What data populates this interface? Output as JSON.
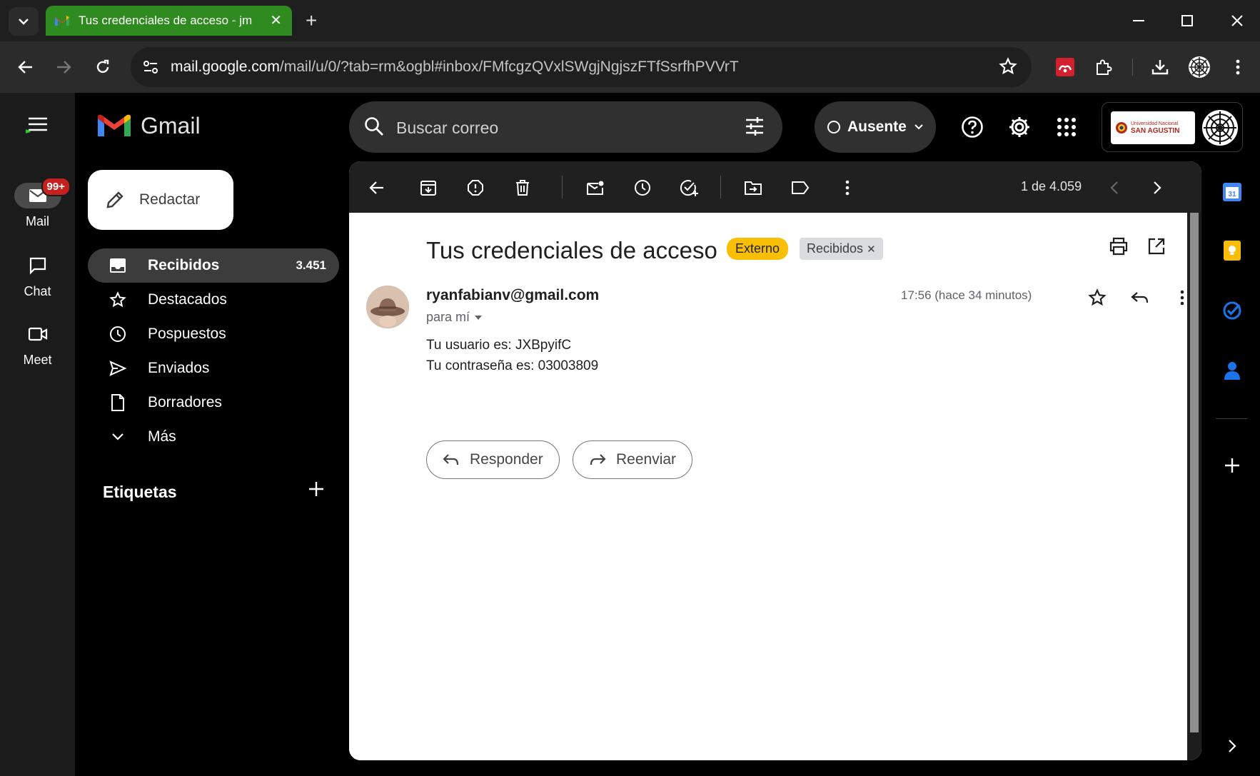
{
  "browser": {
    "tab_title": "Tus credenciales de acceso - jm",
    "url_host": "mail.google.com",
    "url_path": "/mail/u/0/?tab=rm&ogbl#inbox/FMfcgzQVxlSWgjNgjszFTfSsrfhPVVrT"
  },
  "rail": {
    "mail_label": "Mail",
    "mail_badge": "99+",
    "chat_label": "Chat",
    "meet_label": "Meet"
  },
  "sidebar": {
    "app_name": "Gmail",
    "compose_label": "Redactar",
    "items": [
      {
        "label": "Recibidos",
        "count": "3.451",
        "icon": "inbox-icon"
      },
      {
        "label": "Destacados",
        "icon": "star-icon"
      },
      {
        "label": "Pospuestos",
        "icon": "clock-icon"
      },
      {
        "label": "Enviados",
        "icon": "send-icon"
      },
      {
        "label": "Borradores",
        "icon": "draft-icon"
      },
      {
        "label": "Más",
        "icon": "chevron-down-icon"
      }
    ],
    "labels_heading": "Etiquetas"
  },
  "header": {
    "search_placeholder": "Buscar correo",
    "status_label": "Ausente",
    "org_name_small": "Universidad Nacional",
    "org_name": "SAN AGUSTIN"
  },
  "email": {
    "pager": "1 de 4.059",
    "subject": "Tus credenciales de acceso",
    "chip_external": "Externo",
    "chip_inbox": "Recibidos",
    "sender": "ryanfabianv@gmail.com",
    "to": "para mí",
    "time": "17:56 (hace 34 minutos)",
    "body_lines": [
      "Tu usuario es: JXBpyifC",
      "Tu contraseña es: 03003809"
    ],
    "reply_label": "Responder",
    "forward_label": "Reenviar"
  },
  "colors": {
    "tab_active": "#2f8a1f",
    "chip_external": "#f9bf05",
    "badge": "#c5221f"
  }
}
